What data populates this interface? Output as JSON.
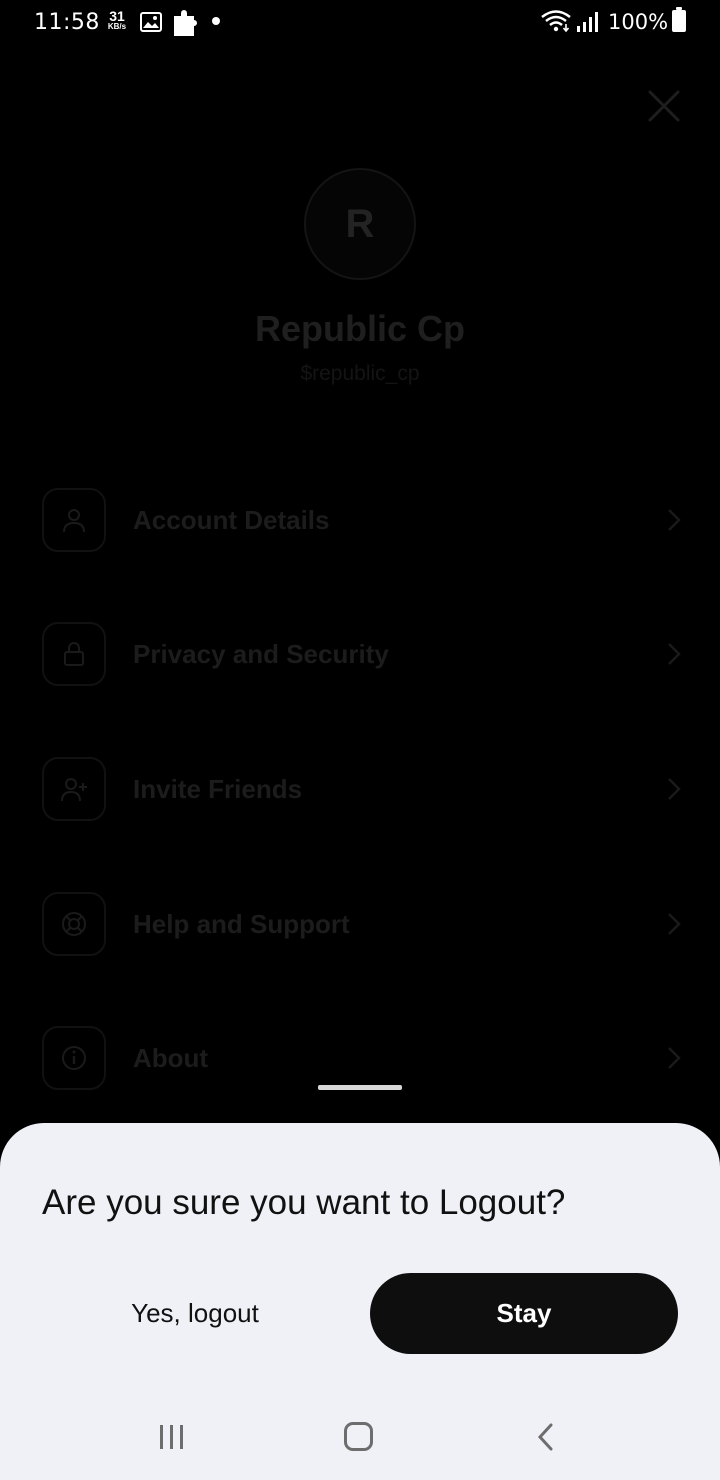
{
  "status_bar": {
    "time": "11:58",
    "net_speed_value": "31",
    "net_speed_unit": "KB/s",
    "battery": "100%",
    "icons": [
      "gallery-icon",
      "puzzle-icon",
      "dot-icon",
      "wifi-icon",
      "signal-icon",
      "battery-icon"
    ]
  },
  "profile": {
    "avatar_initial": "R",
    "name": "Republic Cp",
    "handle": "$republic_cp"
  },
  "menu": {
    "items": [
      {
        "label": "Account Details",
        "icon": "user-icon"
      },
      {
        "label": "Privacy and Security",
        "icon": "lock-icon"
      },
      {
        "label": "Invite Friends",
        "icon": "add-user-icon"
      },
      {
        "label": "Help and Support",
        "icon": "lifebuoy-icon"
      },
      {
        "label": "About",
        "icon": "info-icon"
      }
    ]
  },
  "dialog": {
    "title": "Are you sure you want to Logout?",
    "confirm_label": "Yes, logout",
    "cancel_label": "Stay"
  },
  "colors": {
    "sheet_background": "#f0f1f6",
    "primary_button": "#0e0e0e",
    "overlay": "#000000"
  }
}
